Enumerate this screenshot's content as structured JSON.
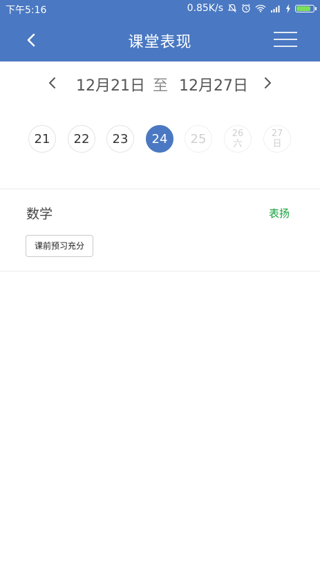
{
  "status_bar": {
    "time": "下午5:16",
    "network_speed": "0.85K/s",
    "icons": [
      "mute-bell-icon",
      "alarm-icon",
      "wifi-icon",
      "signal-icon",
      "charging-icon",
      "battery-icon"
    ]
  },
  "header": {
    "title": "课堂表现",
    "back_icon": "chevron-left-icon",
    "menu_icon": "menu-icon",
    "background_color": "#4a78c2"
  },
  "date_range": {
    "start": "12月21日",
    "separator": "至",
    "end": "12月27日"
  },
  "days": [
    {
      "day": "21",
      "label": ""
    },
    {
      "day": "22",
      "label": ""
    },
    {
      "day": "23",
      "label": ""
    },
    {
      "day": "24",
      "label": "",
      "selected": true
    },
    {
      "day": "25",
      "label": "",
      "disabled": true
    },
    {
      "day": "26",
      "label": "六",
      "disabled": true
    },
    {
      "day": "27",
      "label": "日",
      "disabled": true
    }
  ],
  "record": {
    "subject": "数学",
    "result": "表扬",
    "result_color": "#14a23a",
    "tag": "课前预习充分"
  }
}
